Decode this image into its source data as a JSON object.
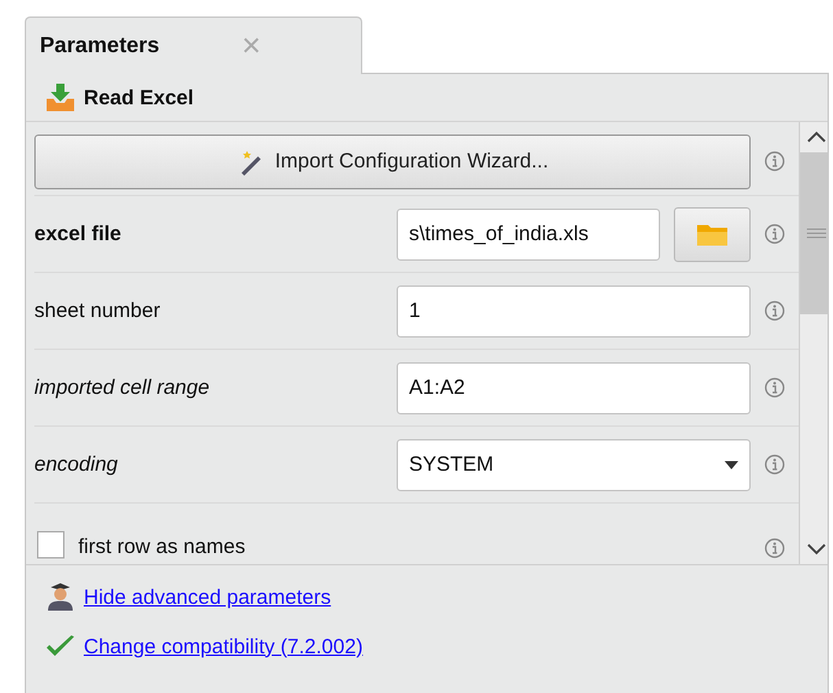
{
  "tab": {
    "title": "Parameters",
    "close": "×"
  },
  "operator": {
    "name": "Read Excel"
  },
  "wizard_button": {
    "label": "Import Configuration Wizard..."
  },
  "parameters": [
    {
      "kind": "file",
      "label": "excel file",
      "bold": true,
      "italic": false,
      "value": "s\\times_of_india.xls"
    },
    {
      "kind": "text",
      "label": "sheet number",
      "bold": false,
      "italic": false,
      "value": "1"
    },
    {
      "kind": "text",
      "label": "imported cell range",
      "bold": false,
      "italic": true,
      "value": "A1:A2"
    },
    {
      "kind": "select",
      "label": "encoding",
      "bold": false,
      "italic": true,
      "value": "SYSTEM"
    },
    {
      "kind": "checkbox",
      "label": "first row as names",
      "bold": false,
      "italic": false,
      "checked": false
    }
  ],
  "links": [
    {
      "kind": "expert",
      "label": "Hide advanced parameters"
    },
    {
      "kind": "check",
      "label": "Change compatibility (7.2.002)"
    }
  ]
}
